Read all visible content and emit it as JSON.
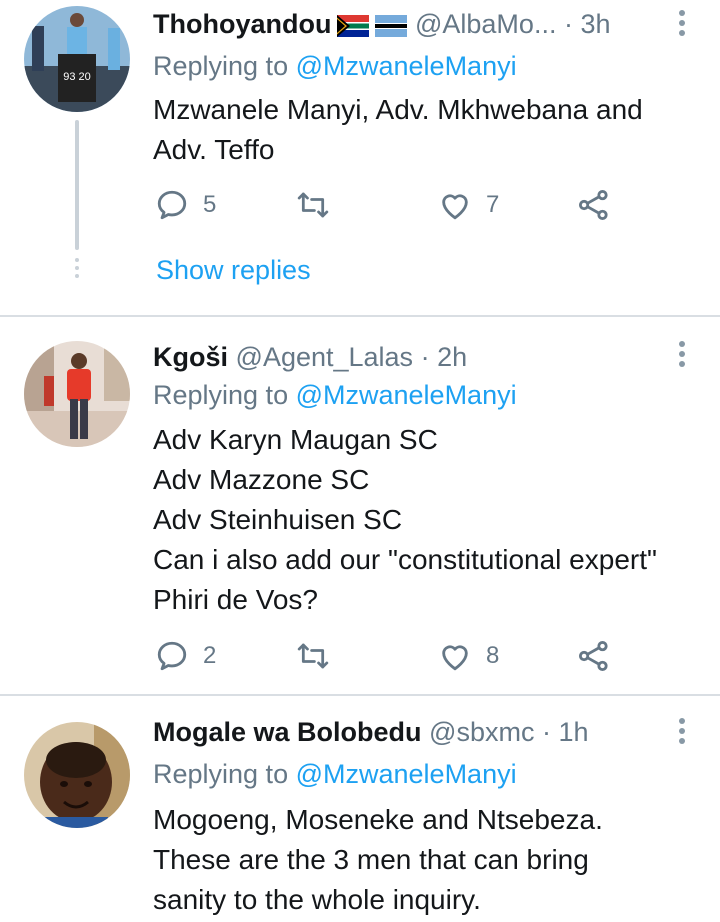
{
  "tweets": [
    {
      "name": "Thohoyandou",
      "handle": "@AlbaMo...",
      "separator": "·",
      "time": "3h",
      "reply_prefix": "Replying to",
      "reply_to": "@MzwaneleManyi",
      "body": [
        "Mzwanele Manyi, Adv. Mkhwebana and",
        "Adv. Teffo"
      ],
      "replies": "5",
      "retweets": "",
      "likes": "7",
      "flags": [
        "south-africa-flag",
        "botswana-flag"
      ],
      "show_replies": "Show replies"
    },
    {
      "name": "Kgoši",
      "handle": "@Agent_Lalas",
      "separator": "·",
      "time": "2h",
      "reply_prefix": "Replying to",
      "reply_to": "@MzwaneleManyi",
      "body": [
        "Adv Karyn Maugan SC",
        "Adv Mazzone SC",
        "Adv Steinhuisen SC",
        "Can i also add our \"constitutional expert\"",
        "Phiri de Vos?"
      ],
      "replies": "2",
      "retweets": "",
      "likes": "8"
    },
    {
      "name": "Mogale wa Bolobedu",
      "handle": "@sbxmc",
      "separator": "·",
      "time": "1h",
      "reply_prefix": "Replying to",
      "reply_to": "@MzwaneleManyi",
      "body": [
        "Mogoeng, Moseneke and Ntsebeza.",
        "These are the 3 men that can bring",
        "sanity to the whole inquiry."
      ]
    }
  ],
  "colors": {
    "link": "#1da1f2",
    "muted": "#657786",
    "text": "#14171a",
    "divider": "#d9dee3"
  }
}
